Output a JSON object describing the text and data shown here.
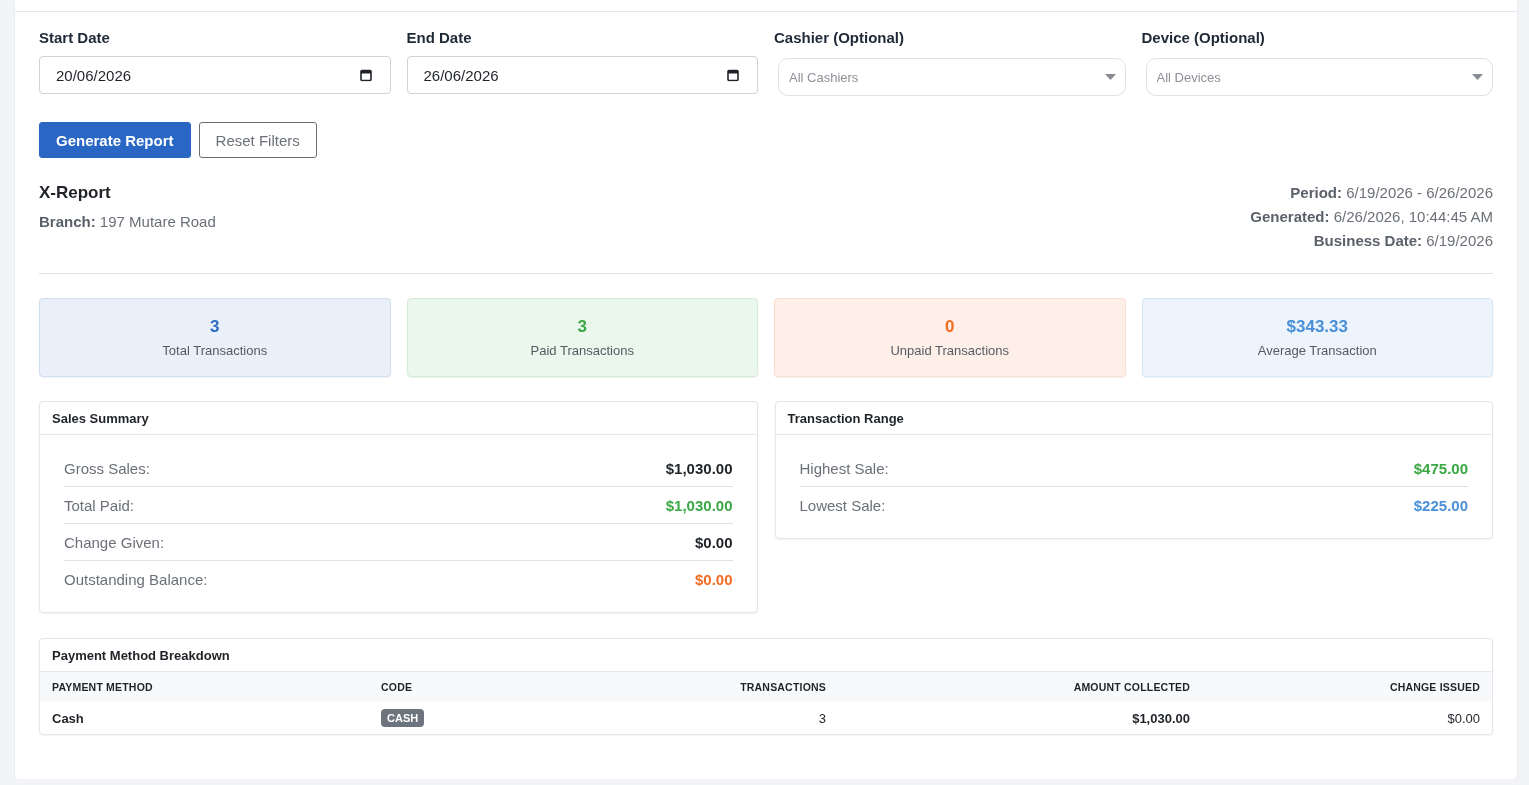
{
  "filters": [
    {
      "kind": "date",
      "label": "Start Date",
      "value": "20/06/2026"
    },
    {
      "kind": "date",
      "label": "End Date",
      "value": "26/06/2026"
    },
    {
      "kind": "select",
      "label": "Cashier (Optional)",
      "placeholder": "All Cashiers"
    },
    {
      "kind": "select",
      "label": "Device (Optional)",
      "placeholder": "All Devices"
    }
  ],
  "actions": [
    {
      "kind": "primary",
      "label": "Generate Report"
    },
    {
      "kind": "secondary",
      "label": "Reset Filters"
    }
  ],
  "report": {
    "title": "X-Report",
    "branch": "**Branch:** 197 Mutare Road",
    "meta": [
      "**Period:** 6/19/2026 - 6/26/2026",
      "**Generated:** 6/26/2026, 10:44:45 AM",
      "**Business Date:** 6/19/2026"
    ]
  },
  "stats": [
    {
      "value": "3",
      "label": "Total Transactions",
      "color": "#2d6cc0"
    },
    {
      "value": "3",
      "label": "Paid Transactions",
      "color": "#3aa845"
    },
    {
      "value": "0",
      "label": "Unpaid Transactions",
      "color": "#f26b21"
    },
    {
      "value": "$343.33",
      "label": "Average Transaction",
      "color": "#4a90d9"
    }
  ],
  "sales_summary": {
    "title": "Sales Summary",
    "rows": [
      {
        "label": "Gross Sales:",
        "value": "$1,030.00",
        "color": "#1f2328"
      },
      {
        "label": "Total Paid:",
        "value": "$1,030.00",
        "color": "#3aa845"
      },
      {
        "label": "Change Given:",
        "value": "$0.00",
        "color": "#1f2328"
      },
      {
        "label": "Outstanding Balance:",
        "value": "$0.00",
        "color": "#f26b21"
      }
    ]
  },
  "transaction_range": {
    "title": "Transaction Range",
    "rows": [
      {
        "label": "Highest Sale:",
        "value": "$475.00",
        "color": "#3aa845"
      },
      {
        "label": "Lowest Sale:",
        "value": "$225.00",
        "color": "#4a90d9"
      }
    ]
  },
  "payment_breakdown": {
    "title": "Payment Method Breakdown",
    "columns": [
      "PAYMENT METHOD",
      "CODE",
      "TRANSACTIONS",
      "AMOUNT COLLECTED",
      "CHANGE ISSUED"
    ],
    "rows": [
      {
        "method": "Cash",
        "code": "CASH",
        "transactions": "3",
        "amount_collected": "$1,030.00",
        "change_issued": "$0.00"
      }
    ]
  }
}
